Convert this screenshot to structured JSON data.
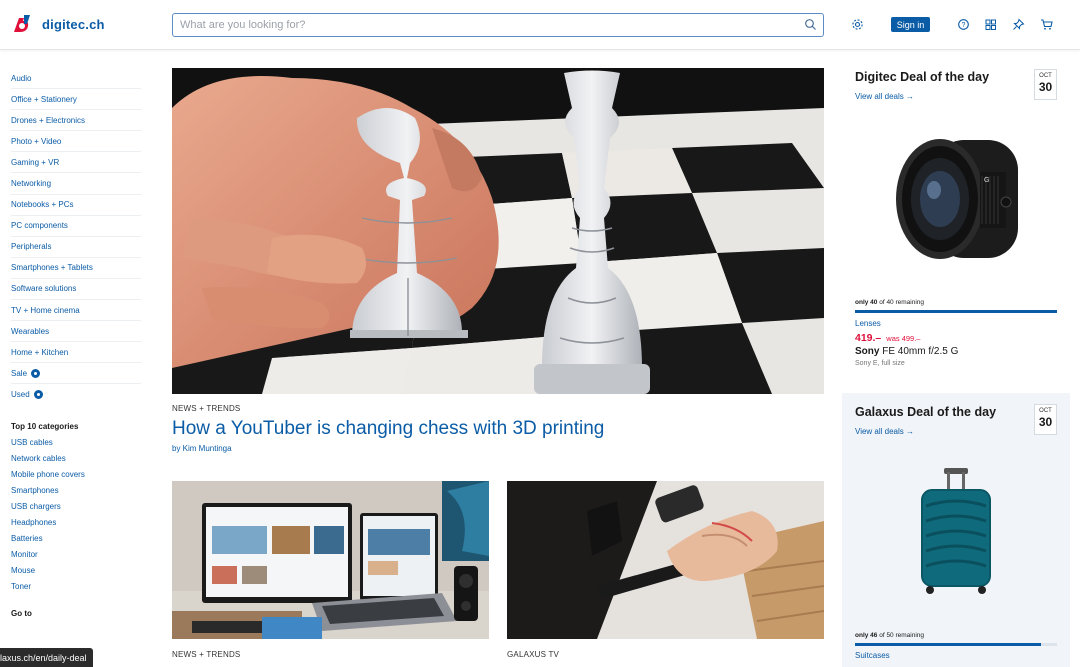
{
  "header": {
    "logo_text": "digitec.ch",
    "search_placeholder": "What are you looking for?",
    "sign_in_label": "Sign in",
    "icons": [
      "search-icon",
      "settings-icon",
      "help-icon",
      "compare-icon",
      "pin-icon",
      "cart-icon"
    ]
  },
  "sidebar": {
    "items": [
      {
        "label": "Audio"
      },
      {
        "label": "Office + Stationery"
      },
      {
        "label": "Drones + Electronics"
      },
      {
        "label": "Photo + Video"
      },
      {
        "label": "Gaming + VR"
      },
      {
        "label": "Networking"
      },
      {
        "label": "Notebooks + PCs"
      },
      {
        "label": "PC components"
      },
      {
        "label": "Peripherals"
      },
      {
        "label": "Smartphones + Tablets"
      },
      {
        "label": "Software solutions"
      },
      {
        "label": "TV + Home cinema"
      },
      {
        "label": "Wearables"
      },
      {
        "label": "Home + Kitchen"
      },
      {
        "label": "Sale"
      },
      {
        "label": "Used"
      }
    ],
    "top10_heading": "Top 10 categories",
    "top10": [
      "USB cables",
      "Network cables",
      "Mobile phone covers",
      "Smartphones",
      "USB chargers",
      "Headphones",
      "Batteries",
      "Monitor",
      "Mouse",
      "Toner"
    ],
    "goto_heading": "Go to"
  },
  "main": {
    "hero": {
      "kicker": "NEWS + TRENDS",
      "title": "How a YouTuber is changing chess with 3D printing",
      "author": "by Kim Muntinga"
    },
    "cards": [
      {
        "kicker": "NEWS + TRENDS"
      },
      {
        "kicker": "GALAXUS TV"
      }
    ]
  },
  "deals": [
    {
      "title": "Digitec Deal of the day",
      "link": "View all deals",
      "month": "OCT",
      "day": "30",
      "remaining_count": "only 40",
      "remaining_rest": "of 40 remaining",
      "remaining_fraction": 1.0,
      "category": "Lenses",
      "price": "419.–",
      "was_price": "was 499.–",
      "brand": "Sony",
      "product": "FE 40mm f/2.5 G",
      "subtitle": "Sony E, full size"
    },
    {
      "title": "Galaxus Deal of the day",
      "link": "View all deals",
      "month": "OCT",
      "day": "30",
      "remaining_count": "only 46",
      "remaining_rest": "of 50 remaining",
      "remaining_fraction": 0.92,
      "category": "Suitcases"
    }
  ],
  "status_url": "laxus.ch/en/daily-deal",
  "colors": {
    "brand": "#0b5ca6",
    "price": "#e0103a"
  }
}
